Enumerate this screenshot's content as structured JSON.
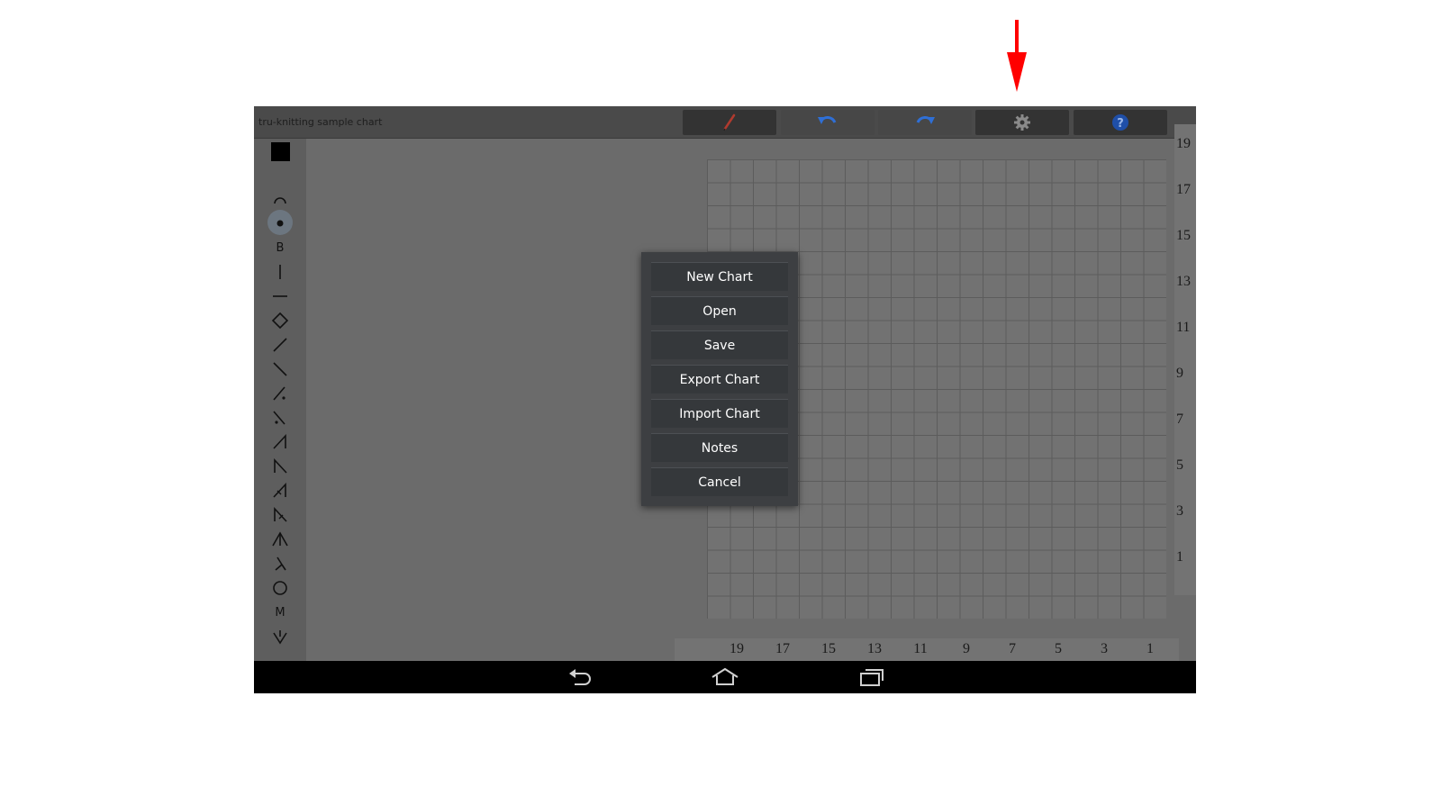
{
  "app": {
    "title": "tru-knitting sample chart"
  },
  "toolbar": {
    "buttons": [
      {
        "name": "pencil-button",
        "icon": "pencil-icon"
      },
      {
        "name": "undo-button",
        "icon": "undo-icon"
      },
      {
        "name": "redo-button",
        "icon": "redo-icon"
      },
      {
        "name": "settings-button",
        "icon": "gear-icon"
      },
      {
        "name": "help-button",
        "icon": "help-icon"
      }
    ]
  },
  "sidebar": {
    "selected_color": "#000000",
    "tools": [
      {
        "icon": "arc-icon"
      },
      {
        "icon": "dot-icon",
        "selected": true
      },
      {
        "label": "B"
      },
      {
        "icon": "vertical-line-icon"
      },
      {
        "icon": "horizontal-line-icon"
      },
      {
        "icon": "diamond-icon"
      },
      {
        "icon": "slash-right-icon"
      },
      {
        "icon": "slash-left-icon"
      },
      {
        "icon": "slash-right-dot-icon"
      },
      {
        "icon": "slash-left-dot-icon"
      },
      {
        "icon": "right-decrease-icon"
      },
      {
        "icon": "left-decrease-icon"
      },
      {
        "icon": "right-decrease-bar-icon"
      },
      {
        "icon": "left-decrease-bar-icon"
      },
      {
        "icon": "double-decrease-icon"
      },
      {
        "icon": "inverted-y-icon"
      },
      {
        "icon": "circle-icon"
      },
      {
        "label": "M"
      },
      {
        "icon": "make-one-arrow-icon"
      }
    ]
  },
  "chart": {
    "row_numbers": [
      "19",
      "17",
      "15",
      "13",
      "11",
      "9",
      "7",
      "5",
      "3",
      "1"
    ],
    "column_numbers": [
      "19",
      "17",
      "15",
      "13",
      "11",
      "9",
      "7",
      "5",
      "3",
      "1"
    ],
    "rows": 20,
    "columns": 20
  },
  "menu": {
    "items": [
      "New Chart",
      "Open",
      "Save",
      "Export Chart",
      "Import Chart",
      "Notes",
      "Cancel"
    ]
  },
  "navbar": {
    "buttons": [
      {
        "name": "back-button",
        "icon": "back-icon"
      },
      {
        "name": "home-button",
        "icon": "home-icon"
      },
      {
        "name": "recent-apps-button",
        "icon": "recent-apps-icon"
      }
    ]
  },
  "annotation": {
    "arrow_color": "#ff0000"
  }
}
